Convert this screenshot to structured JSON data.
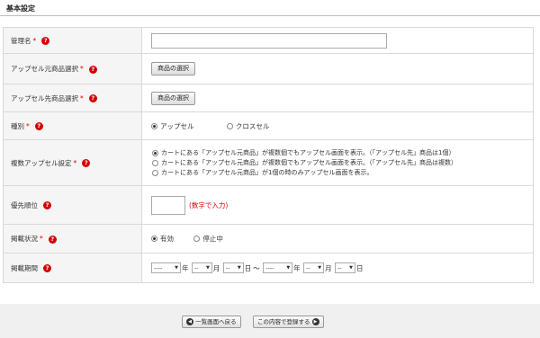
{
  "section_title": "基本設定",
  "fields": {
    "name": {
      "label": "管理名",
      "required": "*",
      "help": "?"
    },
    "upsell_source": {
      "label": "アップセル元商品選択",
      "required": "*",
      "help": "?",
      "button": "商品の選択"
    },
    "upsell_target": {
      "label": "アップセル先商品選択",
      "required": "*",
      "help": "?",
      "button": "商品の選択"
    },
    "type": {
      "label": "種別",
      "required": "*",
      "help": "?",
      "options": [
        "アップセル",
        "クロスセル"
      ],
      "selected": "アップセル"
    },
    "multi": {
      "label": "複数アップセル設定",
      "required": "*",
      "help": "?",
      "options": [
        "カートにある「アップセル元商品」が複数個でもアップセル画面を表示。（「アップセル先」商品は1個）",
        "カートにある「アップセル元商品」が複数個でもアップセル画面を表示。（「アップセル先」商品は複数）",
        "カートにある「アップセル元商品」が1個の時のみアップセル画面を表示。"
      ],
      "selected": 0
    },
    "priority": {
      "label": "優先順位",
      "help": "?",
      "hint": "(数字で入力)"
    },
    "status": {
      "label": "掲載状況",
      "required": "*",
      "help": "?",
      "options": [
        "有効",
        "停止中"
      ],
      "selected": "有効"
    },
    "period": {
      "label": "掲載期間",
      "help": "?",
      "start": {
        "year": "----",
        "month": "--",
        "day": "--"
      },
      "end": {
        "year": "----",
        "month": "--",
        "day": "--"
      },
      "unit_year": "年",
      "unit_month": "月",
      "unit_day": "日",
      "separator": "～"
    }
  },
  "footer": {
    "back_label": "一覧画面へ戻る",
    "back_icon": "chevron-left-icon",
    "submit_label": "この内容で登録する",
    "submit_icon": "chevron-right-icon"
  }
}
